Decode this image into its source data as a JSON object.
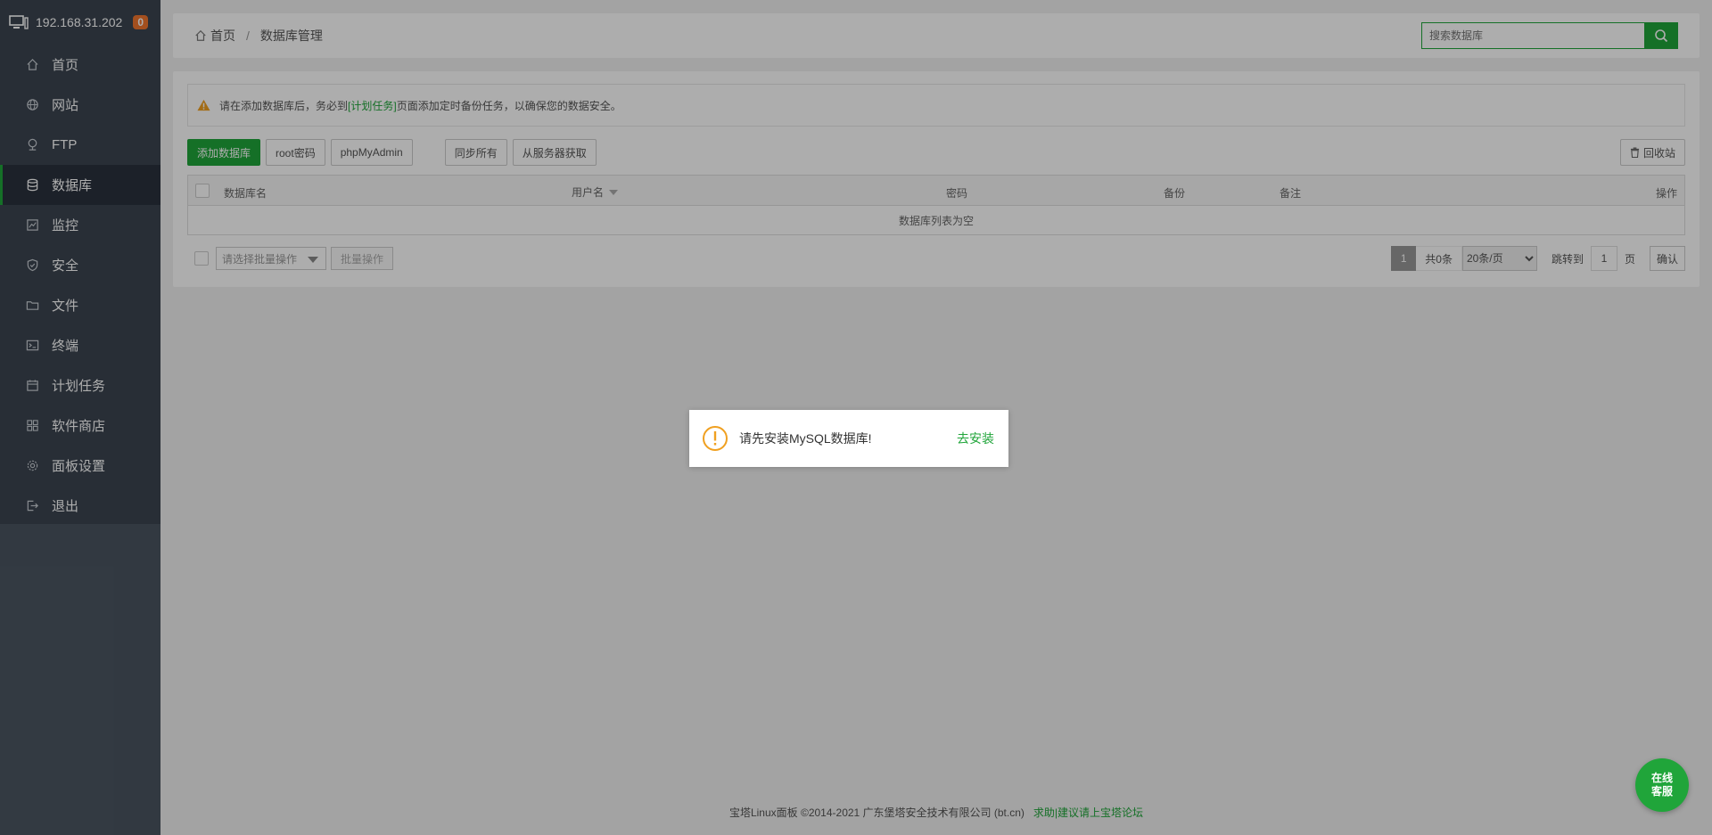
{
  "sidebar": {
    "ip": "192.168.31.202",
    "badge": "0",
    "items": [
      {
        "label": "首页",
        "icon": "home-icon"
      },
      {
        "label": "网站",
        "icon": "globe-icon"
      },
      {
        "label": "FTP",
        "icon": "ftp-icon"
      },
      {
        "label": "数据库",
        "icon": "database-icon",
        "active": true
      },
      {
        "label": "监控",
        "icon": "monitor-icon"
      },
      {
        "label": "安全",
        "icon": "shield-icon"
      },
      {
        "label": "文件",
        "icon": "folder-icon"
      },
      {
        "label": "终端",
        "icon": "terminal-icon"
      },
      {
        "label": "计划任务",
        "icon": "calendar-icon"
      },
      {
        "label": "软件商店",
        "icon": "apps-icon"
      },
      {
        "label": "面板设置",
        "icon": "gear-icon"
      },
      {
        "label": "退出",
        "icon": "logout-icon"
      }
    ]
  },
  "header": {
    "breadcrumb_home": "首页",
    "breadcrumb_separator": "/",
    "breadcrumb_current": "数据库管理",
    "search_placeholder": "搜索数据库"
  },
  "alert": {
    "text_before": "请在添加数据库后，务必到",
    "link": "[计划任务]",
    "text_after": "页面添加定时备份任务，以确保您的数据安全。"
  },
  "toolbar": {
    "add_db": "添加数据库",
    "root_pwd": "root密码",
    "phpmyadmin": "phpMyAdmin",
    "sync_all": "同步所有",
    "fetch_from_server": "从服务器获取",
    "recycle_bin": "回收站"
  },
  "table": {
    "columns": [
      "数据库名",
      "用户名",
      "密码",
      "备份",
      "备注",
      "操作"
    ],
    "empty_text": "数据库列表为空"
  },
  "batch": {
    "select_placeholder": "请选择批量操作",
    "batch_button": "批量操作"
  },
  "pager": {
    "current_page": "1",
    "total": "共0条",
    "per_page": "20条/页",
    "goto_label": "跳转到",
    "goto_value": "1",
    "page_unit": "页",
    "confirm": "确认"
  },
  "footer": {
    "copyright": "宝塔Linux面板 ©2014-2021 广东堡塔安全技术有限公司 (bt.cn)",
    "forum_link": "求助|建议请上宝塔论坛"
  },
  "dialog": {
    "message": "请先安装MySQL数据库!",
    "action": "去安装"
  },
  "chat": {
    "line1": "在线",
    "line2": "客服"
  },
  "colors": {
    "brand_green": "#20a53a",
    "sidebar_bg": "#3b4450",
    "badge_orange": "#f0752d",
    "warning_orange": "#f0a020"
  }
}
